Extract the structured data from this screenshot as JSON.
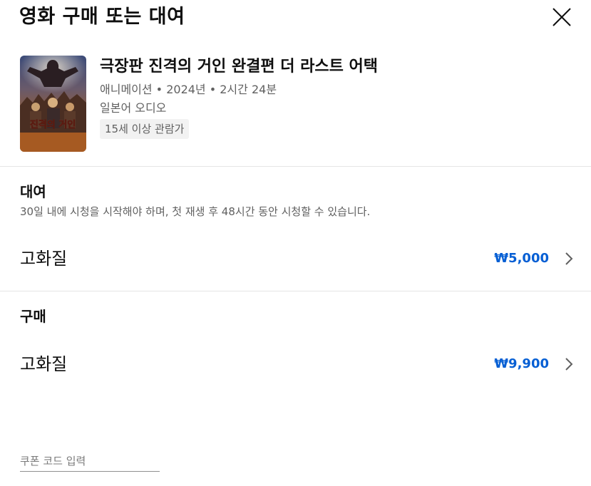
{
  "dialog": {
    "title": "영화 구매 또는 대여"
  },
  "movie": {
    "title": "극장판 진격의 거인 완결편 더 라스트 어택",
    "meta": "애니메이션 • 2024년 • 2시간 24분",
    "audio": "일본어 오디오",
    "rating": "15세 이상 관람가",
    "poster_title": "진격의 거인"
  },
  "rental": {
    "heading": "대여",
    "description": "30일 내에 시청을 시작해야 하며, 첫 재생 후 48시간 동안 시청할 수 있습니다.",
    "option": {
      "label": "고화질",
      "price": "₩5,000"
    }
  },
  "purchase": {
    "heading": "구매",
    "option": {
      "label": "고화질",
      "price": "₩9,900"
    }
  },
  "coupon": {
    "placeholder": "쿠폰 코드 입력"
  },
  "colors": {
    "accent": "#065fd4",
    "text": "#0f0f0f",
    "secondary_text": "#606060",
    "divider": "#e5e5e5"
  },
  "icons": {
    "close": "close-icon",
    "chevron": "chevron-right-icon"
  }
}
